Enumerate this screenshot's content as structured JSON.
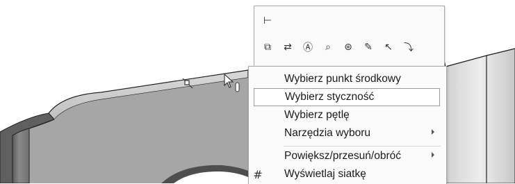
{
  "toolbar": {
    "icons": [
      "smart-dimension-icon",
      "select-other-icon",
      "mirror-dimension-icon",
      "annotation-icon",
      "zoom-to-selection-icon",
      "view-selector-icon",
      "sketch-relations-icon",
      "normal-to-icon",
      "more-commands-icon"
    ]
  },
  "context_menu": {
    "items": [
      {
        "label": "Wybierz punkt środkowy",
        "has_submenu": false,
        "highlighted": false
      },
      {
        "label": "Wybierz styczność",
        "has_submenu": false,
        "highlighted": true
      },
      {
        "label": "Wybierz pętlę",
        "has_submenu": false,
        "highlighted": false
      },
      {
        "label": "Narzędzia wyboru",
        "has_submenu": true,
        "highlighted": false
      },
      {
        "label": "Powiększ/przesuń/obróć",
        "has_submenu": true,
        "highlighted": false
      },
      {
        "label": "Wyświetlaj siatkę",
        "has_submenu": false,
        "highlighted": false,
        "icon": "grid-icon"
      }
    ]
  }
}
